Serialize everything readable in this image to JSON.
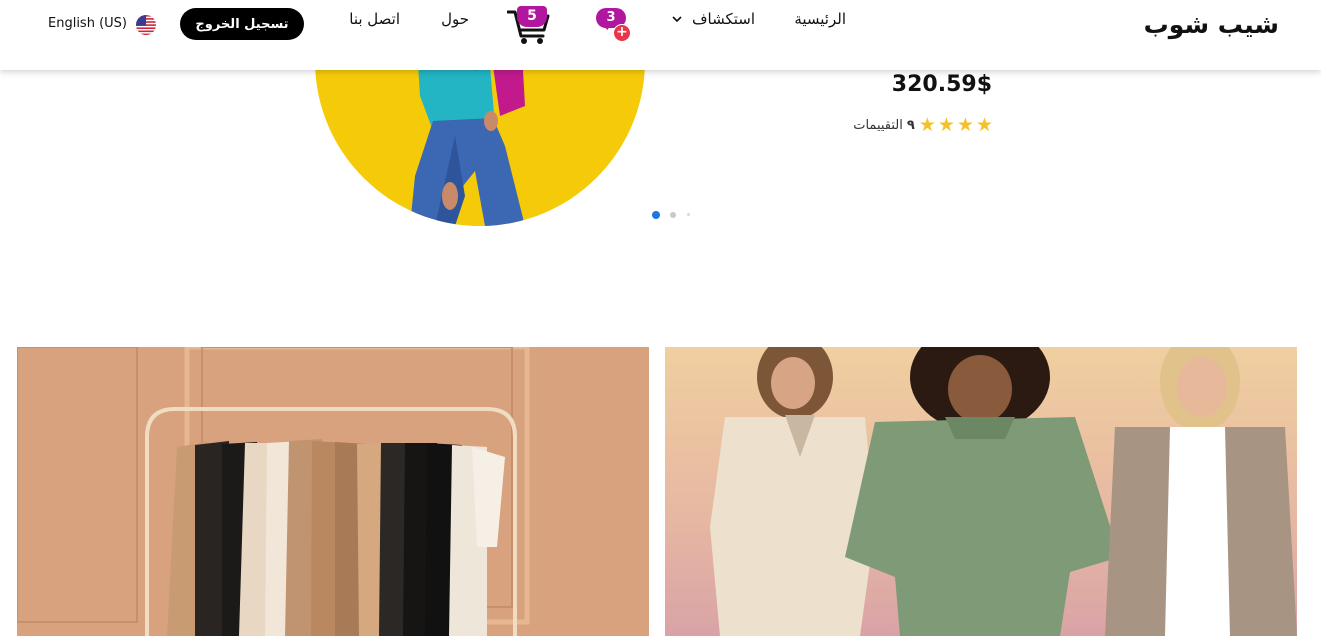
{
  "header": {
    "logo": "شيب شوب",
    "nav": {
      "home": "الرئيسية",
      "explore": "استكشاف",
      "about": "حول",
      "contact": "اتصل بنا"
    },
    "wishlist_count": "3",
    "cart_count": "5",
    "logout_label": "تسجيل الخروج",
    "language": "English (US)",
    "icons": [
      "chevron-down-icon",
      "heart-plus-icon",
      "cart-icon",
      "us-flag-icon"
    ]
  },
  "hero": {
    "price": "320.59$",
    "rating_count": "٩",
    "rating_label": "التقييمات",
    "stars": 4,
    "slides": 3,
    "active_slide": 1
  },
  "colors": {
    "accent_purple": "#b1169e",
    "hero_yellow": "#f5cb09",
    "star_gold": "#f4c12a",
    "active_dot": "#1d74e8",
    "button_black": "#000000"
  }
}
